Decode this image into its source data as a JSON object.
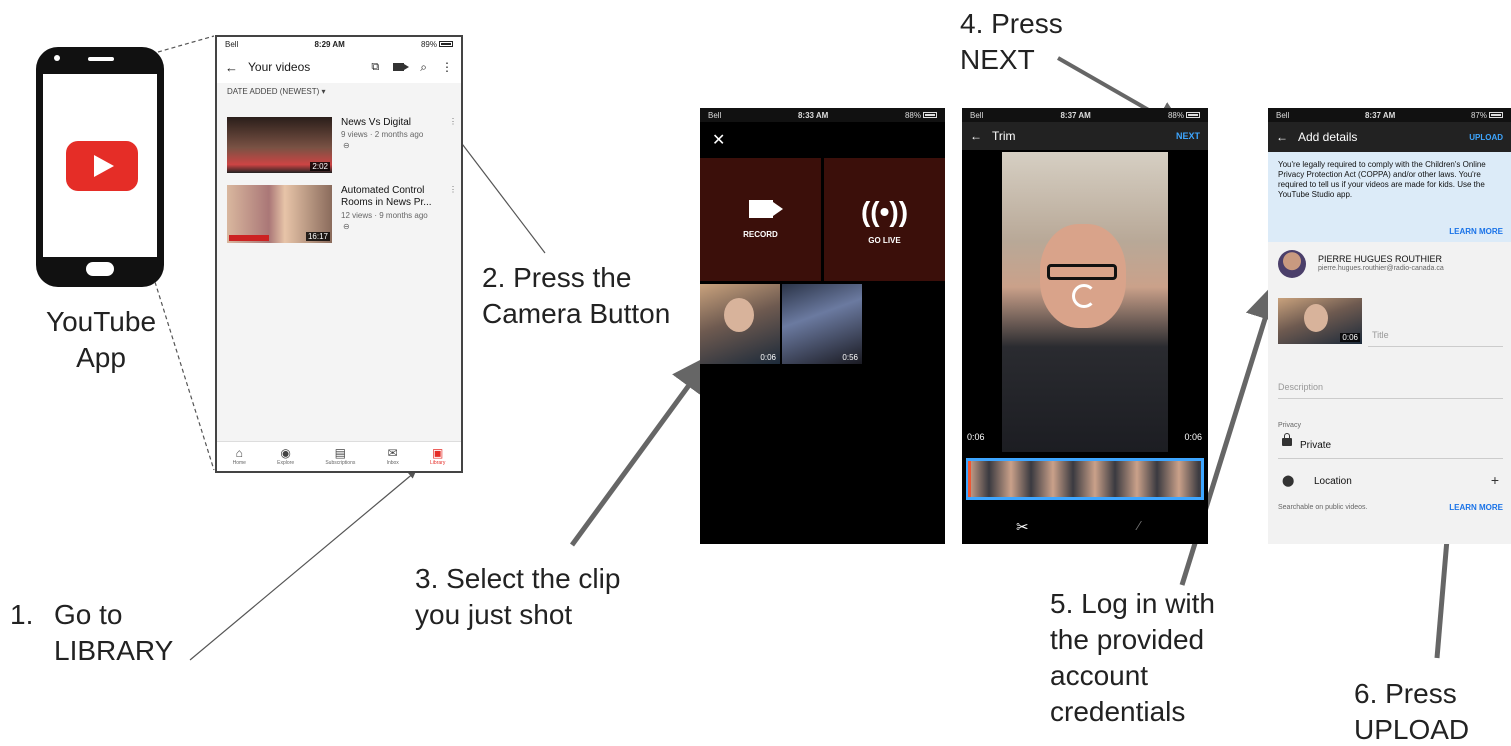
{
  "captions": {
    "app": "YouTube\nApp",
    "step1_number": "1.",
    "step1_text": "Go to\nLIBRARY",
    "step2": "2. Press the\nCamera Button",
    "step3": "3. Select the clip\nyou just shot",
    "step4": "4. Press\nNEXT",
    "step5": "5. Log in with\nthe provided\naccount\ncredentials",
    "step6": "6. Press\nUPLOAD"
  },
  "screen1": {
    "carrier": "Bell",
    "time": "8:29 AM",
    "battery": "89%",
    "title": "Your videos",
    "filter": "DATE ADDED (NEWEST)",
    "videos": [
      {
        "title": "News Vs Digital",
        "meta": "9 views · 2 months ago",
        "duration": "2:02"
      },
      {
        "title": "Automated Control Rooms in News Pr...",
        "meta": "12 views · 9 months ago",
        "duration": "16:17"
      }
    ],
    "nav": [
      "Home",
      "Explore",
      "Subscriptions",
      "Inbox",
      "Library"
    ]
  },
  "screen2": {
    "carrier": "Bell",
    "time": "8:33 AM",
    "battery": "88%",
    "record_label": "RECORD",
    "golive_label": "GO LIVE",
    "clips": [
      {
        "duration": "0:06"
      },
      {
        "duration": "0:56"
      }
    ]
  },
  "screen3": {
    "carrier": "Bell",
    "time": "8:37 AM",
    "battery": "88%",
    "title": "Trim",
    "next_label": "NEXT",
    "start_time": "0:06",
    "end_time": "0:06"
  },
  "screen4": {
    "carrier": "Bell",
    "time": "8:37 AM",
    "battery": "87%",
    "title": "Add details",
    "upload_label": "UPLOAD",
    "notice": "You're legally required to comply with the Children's Online Privacy Protection Act (COPPA) and/or other laws. You're required to tell us if your videos are made for kids. Use the YouTube Studio app.",
    "learn_more": "LEARN MORE",
    "account_name": "PIERRE HUGUES ROUTHIER",
    "account_email": "pierre.hugues.routhier@radio-canada.ca",
    "clip_duration": "0:06",
    "title_placeholder": "Title",
    "description_placeholder": "Description",
    "privacy_label": "Privacy",
    "privacy_value": "Private",
    "location_label": "Location",
    "location_help": "Searchable on public videos.",
    "learn_more_2": "LEARN MORE"
  }
}
